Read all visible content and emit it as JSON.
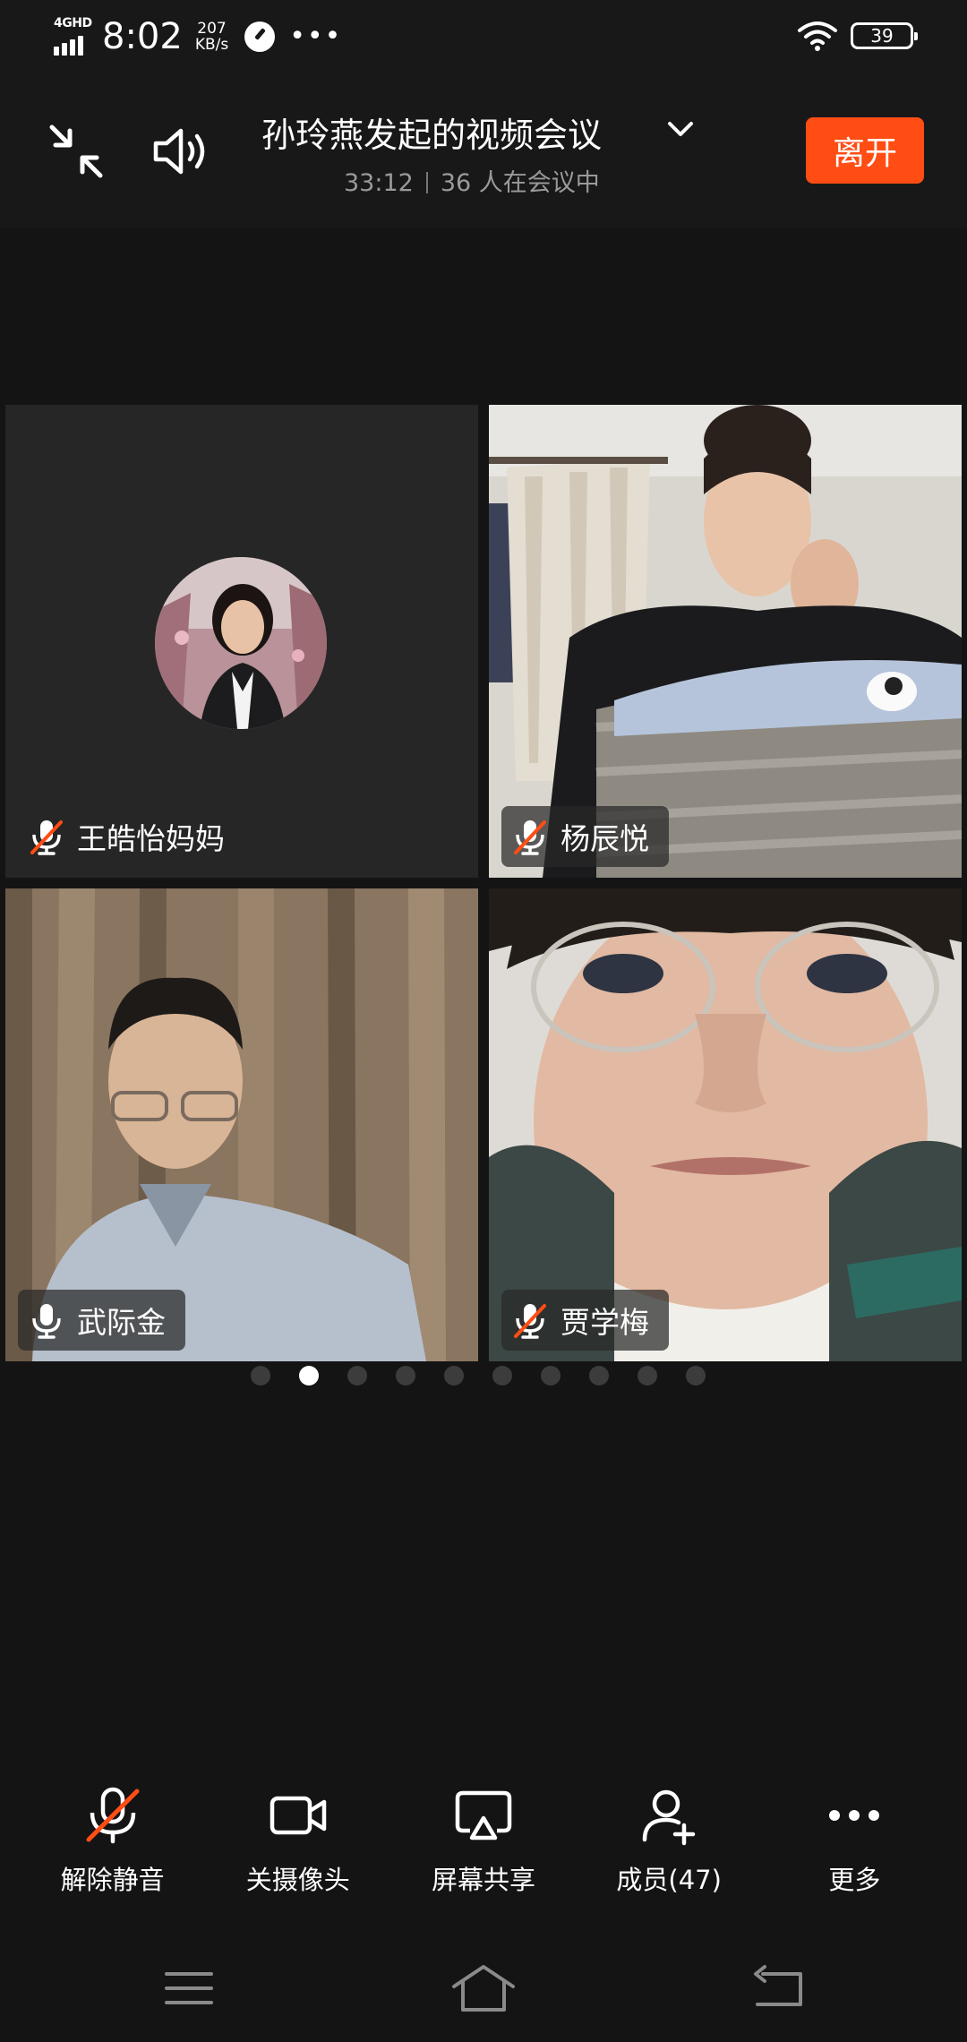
{
  "status_bar": {
    "network": "4GHD",
    "time": "8:02",
    "speed_value": "207",
    "speed_unit": "KB/s",
    "battery": "39"
  },
  "header": {
    "title": "孙玲燕发起的视频会议",
    "duration": "33:12",
    "participants": "36 人在会议中",
    "leave_label": "离开"
  },
  "participants": [
    {
      "name": "王皓怡妈妈",
      "mic": "muted",
      "video": "off"
    },
    {
      "name": "杨辰悦",
      "mic": "muted",
      "video": "on"
    },
    {
      "name": "武际金",
      "mic": "on",
      "video": "on"
    },
    {
      "name": "贾学梅",
      "mic": "muted",
      "video": "on"
    }
  ],
  "pager": {
    "pages": 10,
    "current": 2
  },
  "toolbar": {
    "unmute": "解除静音",
    "camera": "关摄像头",
    "share": "屏幕共享",
    "members": "成员(47)",
    "more": "更多"
  },
  "colors": {
    "accent": "#ff4d14",
    "background": "#141414",
    "muted_slash": "#ff4d14"
  }
}
